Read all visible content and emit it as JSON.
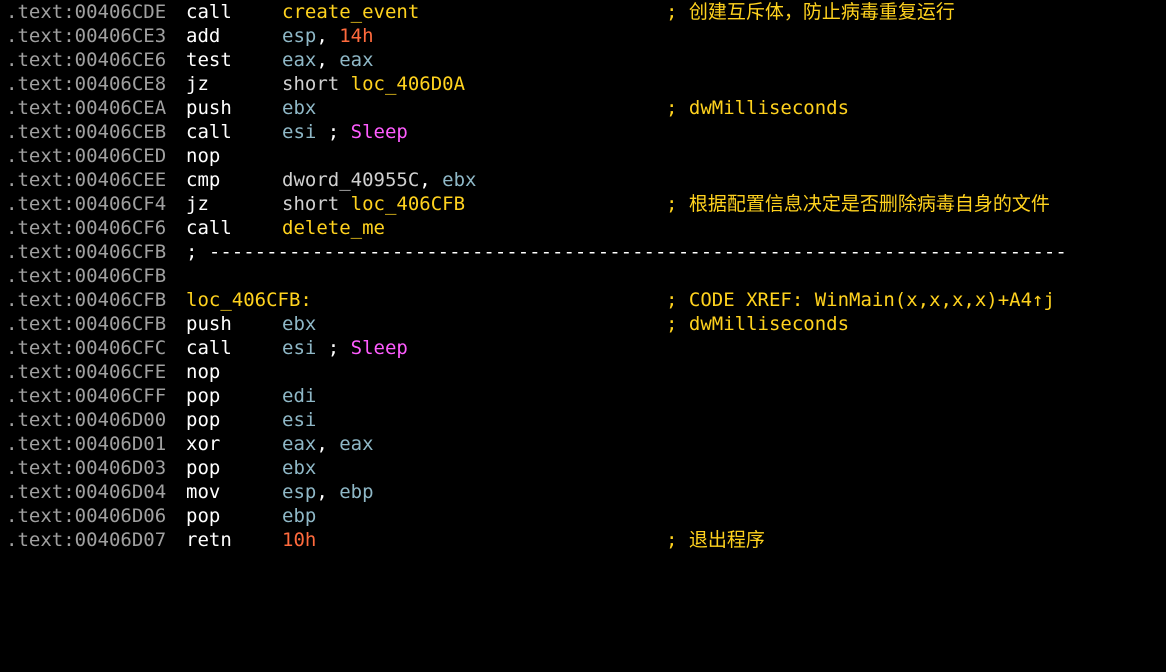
{
  "lines": [
    {
      "addr": ".text:00406CDE",
      "mnemonic": "call",
      "op_sym": "create_event",
      "comment": "; 创建互斥体，防止病毒重复运行"
    },
    {
      "addr": ".text:00406CE3",
      "mnemonic": "add",
      "op_reg": "esp",
      "op_sep": ", ",
      "op_num": "14h"
    },
    {
      "addr": ".text:00406CE6",
      "mnemonic": "test",
      "op_reg": "eax",
      "op_sep": ", ",
      "op_reg2": "eax"
    },
    {
      "addr": ".text:00406CE8",
      "mnemonic": "jz",
      "op_kw": "short ",
      "op_sym": "loc_406D0A"
    },
    {
      "addr": ".text:00406CEA",
      "mnemonic": "push",
      "op_reg": "ebx",
      "comment": "; dwMilliseconds"
    },
    {
      "addr": ".text:00406CEB",
      "mnemonic": "call",
      "op_reg": "esi",
      "op_semi": " ; ",
      "op_api": "Sleep"
    },
    {
      "addr": ".text:00406CED",
      "mnemonic": "nop"
    },
    {
      "addr": ".text:00406CEE",
      "mnemonic": "cmp",
      "op_kw": "dword_40955C",
      "op_sep": ", ",
      "op_reg": "ebx"
    },
    {
      "addr": ".text:00406CF4",
      "mnemonic": "jz",
      "op_kw": "short ",
      "op_sym": "loc_406CFB",
      "comment": "; 根据配置信息决定是否删除病毒自身的文件"
    },
    {
      "addr": ".text:00406CF6",
      "mnemonic": "call",
      "op_sym": "delete_me"
    },
    {
      "addr": ".text:00406CFB",
      "separator": "; ---------------------------------------------------------------------------"
    },
    {
      "addr": ".text:00406CFB"
    },
    {
      "addr": ".text:00406CFB",
      "label": "loc_406CFB:",
      "comment": "; CODE XREF: WinMain(x,x,x,x)+A4↑j"
    },
    {
      "addr": ".text:00406CFB",
      "mnemonic": "push",
      "op_reg": "ebx",
      "comment": "; dwMilliseconds"
    },
    {
      "addr": ".text:00406CFC",
      "mnemonic": "call",
      "op_reg": "esi",
      "op_semi": " ; ",
      "op_api": "Sleep"
    },
    {
      "addr": ".text:00406CFE",
      "mnemonic": "nop"
    },
    {
      "addr": ".text:00406CFF",
      "mnemonic": "pop",
      "op_reg": "edi"
    },
    {
      "addr": ".text:00406D00",
      "mnemonic": "pop",
      "op_reg": "esi"
    },
    {
      "addr": ".text:00406D01",
      "mnemonic": "xor",
      "op_reg": "eax",
      "op_sep": ", ",
      "op_reg2": "eax"
    },
    {
      "addr": ".text:00406D03",
      "mnemonic": "pop",
      "op_reg": "ebx"
    },
    {
      "addr": ".text:00406D04",
      "mnemonic": "mov",
      "op_reg": "esp",
      "op_sep": ", ",
      "op_reg2": "ebp"
    },
    {
      "addr": ".text:00406D06",
      "mnemonic": "pop",
      "op_reg": "ebp"
    },
    {
      "addr": ".text:00406D07",
      "mnemonic": "retn",
      "op_num": "10h",
      "comment": "; 退出程序"
    }
  ]
}
